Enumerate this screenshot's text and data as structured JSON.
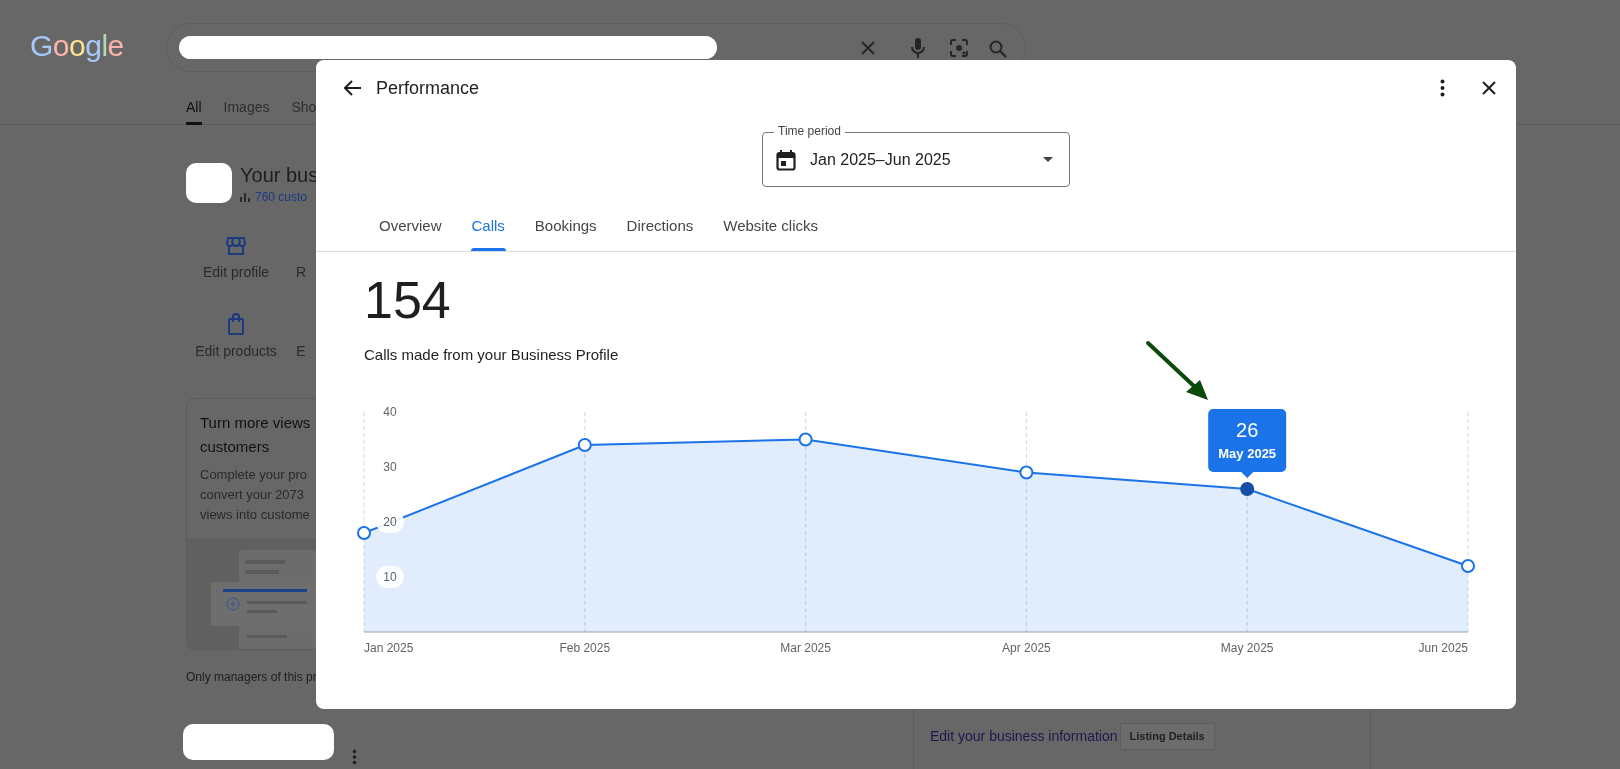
{
  "background_page": {
    "logo": "Google",
    "search_tabs": [
      {
        "label": "All",
        "selected": true
      },
      {
        "label": "Images",
        "selected": false
      },
      {
        "label": "Sho",
        "selected": false
      }
    ],
    "business": {
      "name": "Your bus",
      "stat": "760 custo"
    },
    "actions": [
      {
        "label": "Edit profile",
        "kind": "store"
      },
      {
        "label": "R",
        "kind": "hidden"
      },
      {
        "label": "Edit products",
        "kind": "bag"
      },
      {
        "label": "E",
        "kind": "hidden"
      }
    ],
    "promo_card": {
      "title_lines": [
        "Turn more views",
        "customers"
      ],
      "body_lines": [
        "Complete your pro",
        "convert your 2073",
        "views into custome"
      ]
    },
    "managers_note": "Only managers of this pr",
    "edit_info": {
      "link": "Edit your business information",
      "button": "Listing Details"
    }
  },
  "dialog": {
    "title": "Performance",
    "time_period": {
      "label": "Time period",
      "value": "Jan 2025–Jun 2025"
    },
    "tabs": [
      {
        "label": "Overview",
        "selected": false
      },
      {
        "label": "Calls",
        "selected": true
      },
      {
        "label": "Bookings",
        "selected": false
      },
      {
        "label": "Directions",
        "selected": false
      },
      {
        "label": "Website clicks",
        "selected": false
      }
    ],
    "total": "154",
    "caption": "Calls made from your Business Profile",
    "chart_data": {
      "type": "area",
      "categories": [
        "Jan 2025",
        "Feb 2025",
        "Mar 2025",
        "Apr 2025",
        "May 2025",
        "Jun 2025"
      ],
      "values": [
        18,
        34,
        35,
        29,
        26,
        12
      ],
      "ylim": [
        0,
        40
      ],
      "yticks": [
        10,
        20,
        30,
        40
      ],
      "grid": true,
      "annotations": [
        {
          "text": "26",
          "x": "May 2025",
          "y": 26
        },
        {
          "text": "May 2025",
          "x": "May 2025",
          "y": 26
        }
      ]
    }
  }
}
